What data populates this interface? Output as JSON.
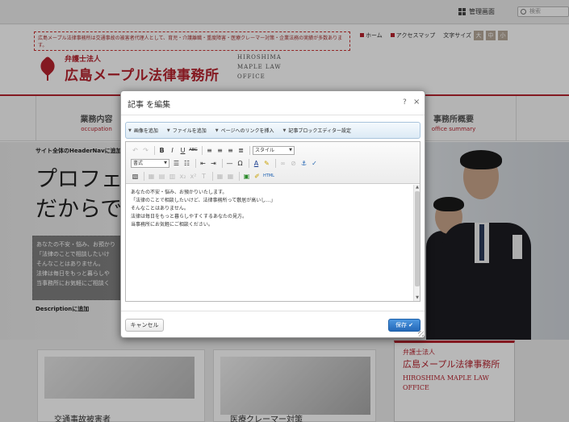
{
  "topbar": {
    "admin_label": "管理画面",
    "search_placeholder": "検索"
  },
  "site": {
    "notice": "広島メープル法律事務所は交通事故の被害者代理人として、育児・介護離職・重度障害・医療クレーマー対策・企業法務の実績が多数あります。",
    "logo_small": "弁護士法人",
    "logo_big": "広島メープル法律事務所",
    "eng_lines": [
      "HIROSHIMA",
      "MAPLE LAW",
      "OFFICE"
    ],
    "links": {
      "home": "ホーム",
      "access": "アクセスマップ",
      "fontsize": "文字サイズ",
      "font_a": "大",
      "font_b": "中",
      "font_c": "小"
    },
    "nav": [
      {
        "jp": "業務内容",
        "en": "occupation"
      },
      {
        "jp": "事務所概要",
        "en": "office summary"
      }
    ],
    "crumb": "サイト全体のHeaderNavに追加",
    "catch_lines": [
      "プロフェ",
      "だからで"
    ],
    "desc_lines": [
      "あなたの不安・悩み、お預かり",
      "「法律のことで相談したいけ",
      "そんなことはありません。",
      "法律は毎日をもっと暮らしや",
      "当事務所にお気軽にご相談く"
    ],
    "desc_label": "Descriptionに追加",
    "card1_title": "交通事故被害者",
    "card2_title": "医療クレーマー対策",
    "card3": {
      "a": "弁護士法人",
      "b": "広島メープル法律事務所",
      "c1": "HIROSHIMA MAPLE LAW",
      "c2": "OFFICE"
    }
  },
  "dialog": {
    "title": "記事 を編集",
    "help": "?",
    "close": "×",
    "blockbar": [
      "画像を追加",
      "ファイルを追加",
      "ページへのリンクを挿入",
      "記事ブロックエディター設定"
    ],
    "toolbar": {
      "style_select": "スタイル",
      "format_select": "書式",
      "html_label": "HTML"
    },
    "content_lines": [
      "あなたの不安・悩み、お預かりいたします。",
      "「法律のことで相談したいけど、法律事務所って敷居が高いし…」",
      "そんなことはありません。",
      "法律は毎日をもっと暮らしやすくするあなたの見方。",
      "当事務所にお気軽にご相談ください。"
    ],
    "cancel_label": "キャンセル",
    "save_label": "保存 ✔"
  }
}
